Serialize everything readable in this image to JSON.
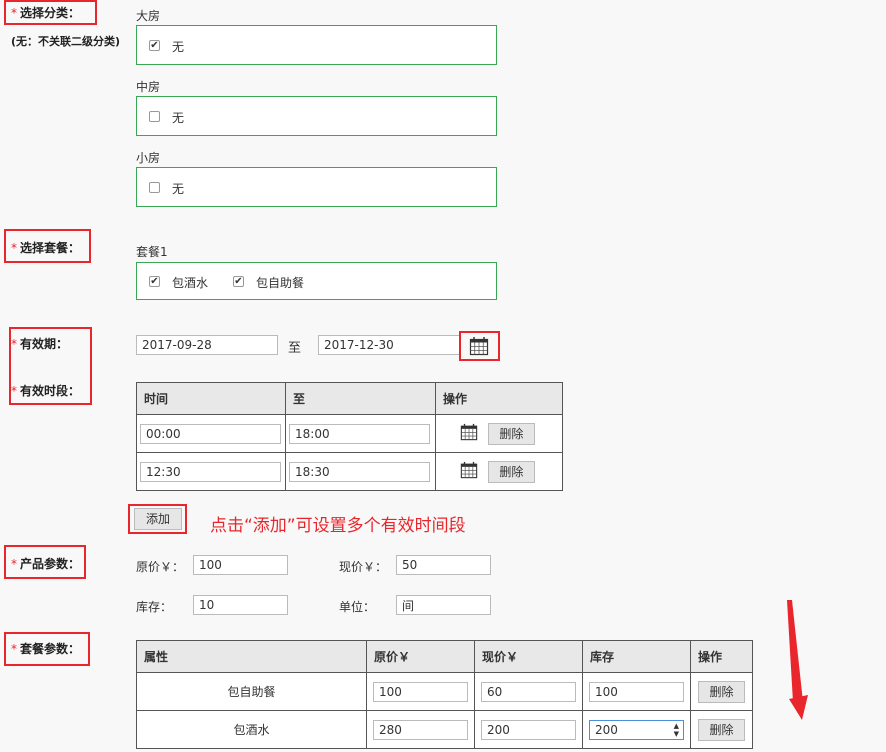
{
  "labels": {
    "category": "选择分类：",
    "category_note": "(无：不关联二级分类)",
    "package": "选择套餐：",
    "validity": "有效期：",
    "time_slots": "有效时段：",
    "product_params": "产品参数：",
    "package_params": "套餐参数：",
    "star": "*"
  },
  "categories": [
    {
      "name": "大房",
      "option": "无",
      "checked": true
    },
    {
      "name": "中房",
      "option": "无",
      "checked": false
    },
    {
      "name": "小房",
      "option": "无",
      "checked": false
    }
  ],
  "package": {
    "name": "套餐1",
    "items": [
      {
        "label": "包酒水",
        "checked": true
      },
      {
        "label": "包自助餐",
        "checked": true
      }
    ]
  },
  "validity": {
    "start": "2017-09-28",
    "to": "至",
    "end": "2017-12-30"
  },
  "time_table": {
    "headers": [
      "时间",
      "至",
      "操作"
    ],
    "rows": [
      {
        "start": "00:00",
        "end": "18:00",
        "delete": "删除"
      },
      {
        "start": "12:30",
        "end": "18:30",
        "delete": "删除"
      }
    ],
    "add_button": "添加",
    "annotation": "点击“添加”可设置多个有效时间段"
  },
  "product_params": {
    "original_price_label": "原价￥：",
    "original_price": "100",
    "current_price_label": "现价￥：",
    "current_price": "50",
    "stock_label": "库存：",
    "stock": "10",
    "unit_label": "单位：",
    "unit": "间"
  },
  "package_table": {
    "headers": [
      "属性",
      "原价￥",
      "现价￥",
      "库存",
      "操作"
    ],
    "rows": [
      {
        "attr": "包自助餐",
        "original": "100",
        "current": "60",
        "stock": "100",
        "delete": "删除"
      },
      {
        "attr": "包酒水",
        "original": "280",
        "current": "200",
        "stock": "200",
        "delete": "删除"
      }
    ]
  },
  "colors": {
    "annotation_red": "#e8262b",
    "group_border_green": "#3aa757"
  },
  "icons": {
    "calendar": "calendar-icon",
    "checkbox_checked": "checkmark",
    "stepper": "spinner-arrows"
  }
}
